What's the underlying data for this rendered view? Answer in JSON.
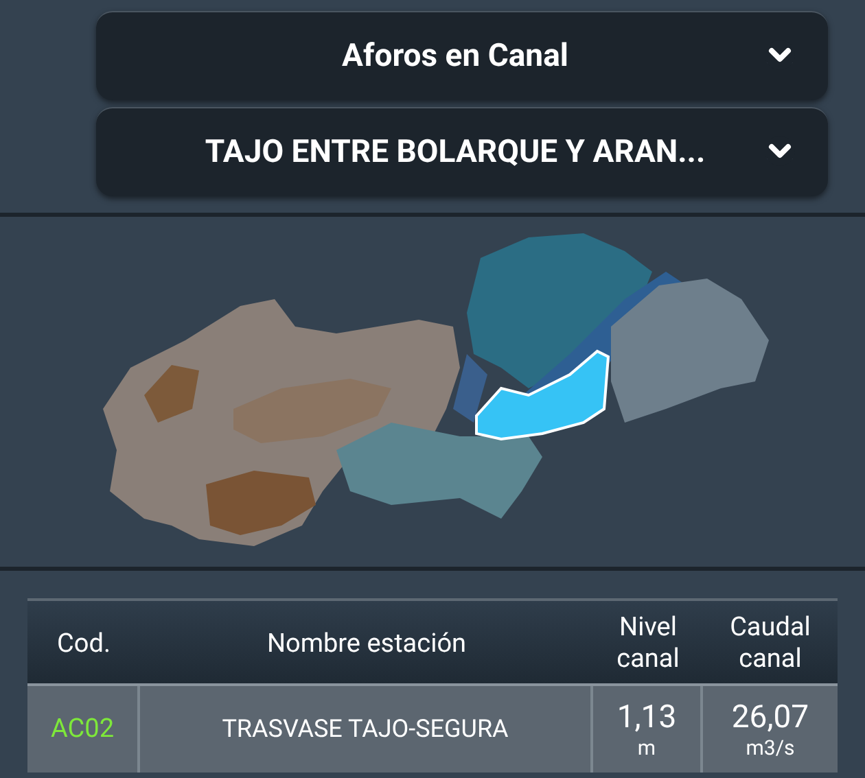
{
  "selectors": [
    {
      "label": "Aforos en Canal"
    },
    {
      "label": "TAJO ENTRE BOLARQUE Y ARAN..."
    }
  ],
  "table": {
    "columns": [
      "Cod.",
      "Nombre estación",
      "Nivel canal",
      "Caudal canal"
    ],
    "rows": [
      {
        "code": "AC02",
        "name": "TRASVASE TAJO-SEGURA",
        "level": "1,13",
        "level_unit": "m",
        "flow": "26,07",
        "flow_unit": "m3/s"
      }
    ]
  }
}
